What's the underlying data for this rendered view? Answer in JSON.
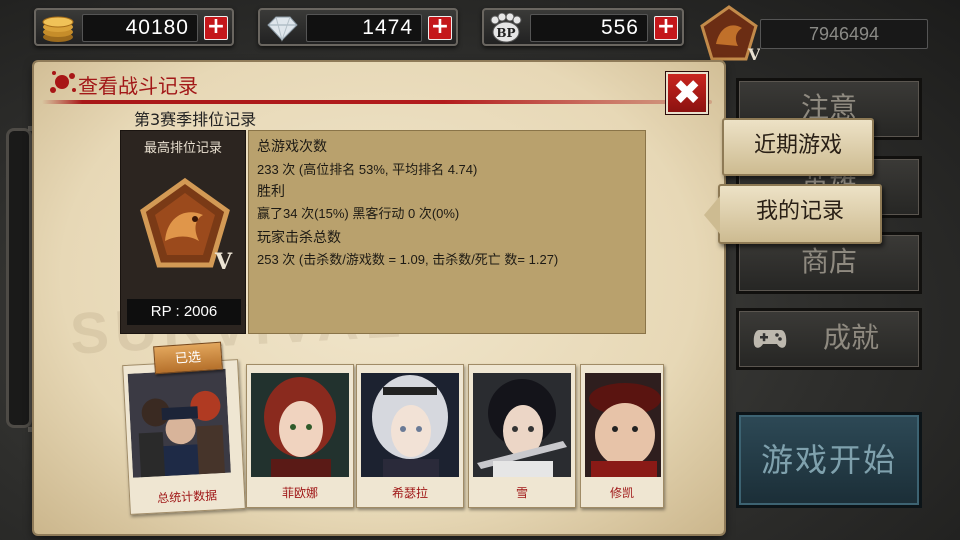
{
  "resources": {
    "gold": {
      "value": "40180",
      "icon": "gold-coins-icon"
    },
    "gems": {
      "value": "1474",
      "icon": "diamond-icon"
    },
    "bp": {
      "value": "556",
      "icon": "bp-paw-icon",
      "label": "BP"
    },
    "plus_label": "+"
  },
  "player": {
    "id": "7946494",
    "rank_letter": "V"
  },
  "panel": {
    "title": "查看战斗记录",
    "close_label": "✖",
    "season_title": "第3赛季排位记录",
    "best_rank_label": "最高排位记录",
    "rank_letter": "V",
    "rp": "RP : 2006"
  },
  "stats": {
    "total_games_label": "总游戏次数",
    "total_games_value": "233 次 (高位排名 53%, 平均排名 4.74)",
    "wins_label": "胜利",
    "wins_value": "赢了34 次(15%) 黑客行动 0 次(0%)",
    "kills_label": "玩家击杀总数",
    "kills_value": "253 次 (击杀数/游戏数 = 1.09, 击杀数/死亡 数= 1.27)"
  },
  "cards": {
    "selected_tag": "已选",
    "total": "总统计数据",
    "fiona": "菲欧娜",
    "ciel": "希瑟拉",
    "snow": "雪",
    "hugh": "修凯"
  },
  "menu": {
    "notice": "注意",
    "hero": "英雄",
    "shop": "商店",
    "achievements": "成就",
    "start": "游戏开始"
  },
  "tabs": {
    "recent": "近期游戏",
    "mine": "我的记录"
  },
  "colors": {
    "accent_red": "#a21818",
    "paper": "#e7d8b6",
    "start_button": "#2d4956"
  }
}
